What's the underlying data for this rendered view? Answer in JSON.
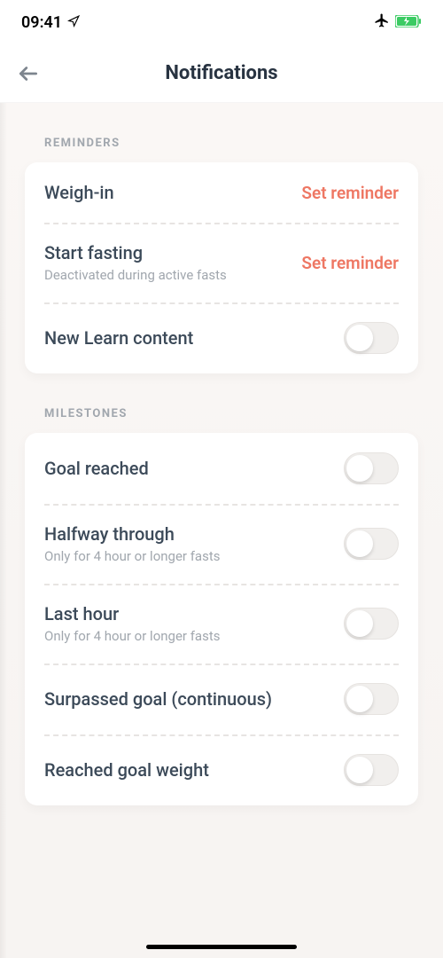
{
  "status": {
    "time": "09:41"
  },
  "header": {
    "title": "Notifications"
  },
  "sections": {
    "reminders": {
      "title": "REMINDERS",
      "weigh_in": {
        "label": "Weigh-in",
        "action": "Set reminder"
      },
      "start_fasting": {
        "label": "Start fasting",
        "sub": "Deactivated during active fasts",
        "action": "Set reminder"
      },
      "new_learn": {
        "label": "New Learn content"
      }
    },
    "milestones": {
      "title": "MILESTONES",
      "goal_reached": {
        "label": "Goal reached"
      },
      "halfway": {
        "label": "Halfway through",
        "sub": "Only for 4 hour or longer fasts"
      },
      "last_hour": {
        "label": "Last hour",
        "sub": "Only for 4 hour or longer fasts"
      },
      "surpassed": {
        "label": "Surpassed goal (continuous)"
      },
      "reached_weight": {
        "label": "Reached goal weight"
      }
    }
  }
}
